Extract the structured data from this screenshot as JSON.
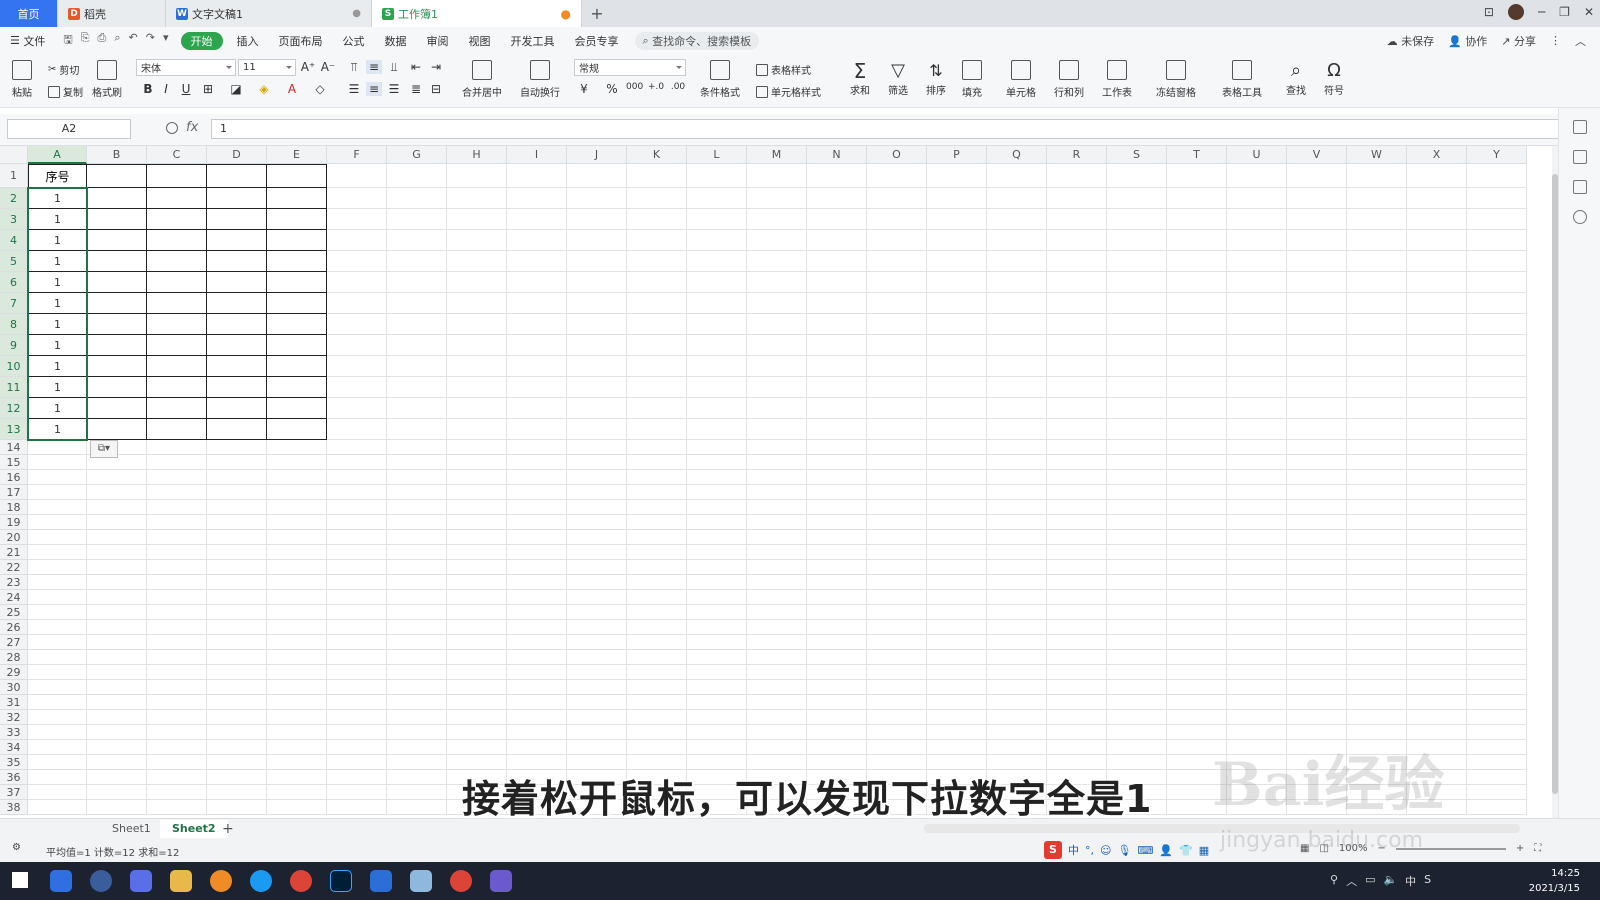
{
  "tabs": {
    "home": "首页",
    "tab1": "稻壳",
    "tab2": "文字文稿1",
    "tab3": "工作簿1",
    "plus": "+"
  },
  "menu": {
    "file": "文件",
    "items": [
      "开始",
      "插入",
      "页面布局",
      "公式",
      "数据",
      "审阅",
      "视图",
      "开发工具",
      "会员专享"
    ],
    "search": "查找命令、搜索模板",
    "right": [
      "未保存",
      "协作",
      "分享"
    ]
  },
  "ribbon": {
    "paste": "粘贴",
    "cut": "剪切",
    "copy": "复制",
    "format_painter": "格式刷",
    "font_name": "宋体",
    "font_size": "11",
    "merge_center": "合并居中",
    "wrap_text": "自动换行",
    "number_format": "常规",
    "cond_format": "条件格式",
    "table_style": "表格样式",
    "cell_style": "单元格样式",
    "sum": "求和",
    "filter": "筛选",
    "sort": "排序",
    "fill": "填充",
    "cell": "单元格",
    "rowcol": "行和列",
    "worksheet": "工作表",
    "freeze": "冻结窗格",
    "table_tools": "表格工具",
    "find": "查找",
    "symbol": "符号"
  },
  "formula_bar": {
    "name_box": "A2",
    "fx": "fx",
    "value": "1"
  },
  "columns": [
    "A",
    "B",
    "C",
    "D",
    "E",
    "F",
    "G",
    "H",
    "I",
    "J",
    "K",
    "L",
    "M",
    "N",
    "O",
    "P",
    "Q",
    "R",
    "S",
    "T",
    "U",
    "V",
    "W",
    "X",
    "Y"
  ],
  "rows": [
    "1",
    "2",
    "3",
    "4",
    "5",
    "6",
    "7",
    "8",
    "9",
    "10",
    "11",
    "12",
    "13",
    "14",
    "15",
    "16",
    "17",
    "18",
    "19",
    "20",
    "21",
    "22",
    "23",
    "24",
    "25",
    "26",
    "27",
    "28",
    "29",
    "30",
    "31",
    "32",
    "33",
    "34",
    "35",
    "36",
    "37",
    "38"
  ],
  "sheet": {
    "header": "序号",
    "values": [
      "1",
      "1",
      "1",
      "1",
      "1",
      "1",
      "1",
      "1",
      "1",
      "1",
      "1",
      "1"
    ]
  },
  "sheet_tabs": [
    "Sheet1",
    "Sheet2"
  ],
  "active_sheet": "Sheet2",
  "status": "平均值=1  计数=12  求和=12",
  "zoom": "100%",
  "subtitle": "接着松开鼠标，可以发现下拉数字全是1",
  "watermark": "Bai经验",
  "watermark_url": "jingyan.baidu.com",
  "clock": {
    "time": "14:25",
    "date": "2021/3/15"
  },
  "ime": "中",
  "colors": {
    "accent": "#217346",
    "home_tab": "#3574f0",
    "active_menu": "#2da44e"
  }
}
